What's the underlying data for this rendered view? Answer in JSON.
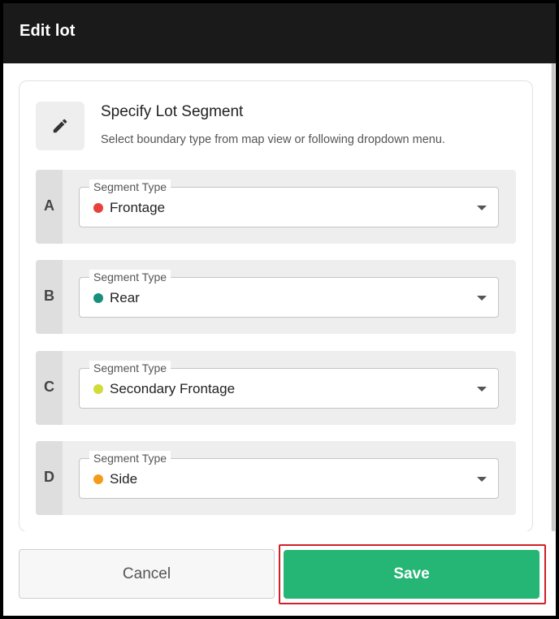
{
  "dialog": {
    "title": "Edit lot"
  },
  "card": {
    "icon": "pencil-icon",
    "title": "Specify Lot Segment",
    "subtitle": "Select boundary type from map view or following dropdown menu."
  },
  "segments": [
    {
      "letter": "A",
      "field_label": "Segment Type",
      "value": "Frontage",
      "color": "#e8403a"
    },
    {
      "letter": "B",
      "field_label": "Segment Type",
      "value": "Rear",
      "color": "#178f7c"
    },
    {
      "letter": "C",
      "field_label": "Segment Type",
      "value": "Secondary Frontage",
      "color": "#cfdc3a"
    },
    {
      "letter": "D",
      "field_label": "Segment Type",
      "value": "Side",
      "color": "#f59b1a"
    }
  ],
  "footer": {
    "cancel_label": "Cancel",
    "save_label": "Save",
    "save_color": "#25b574",
    "highlight_color": "#d0212a"
  }
}
